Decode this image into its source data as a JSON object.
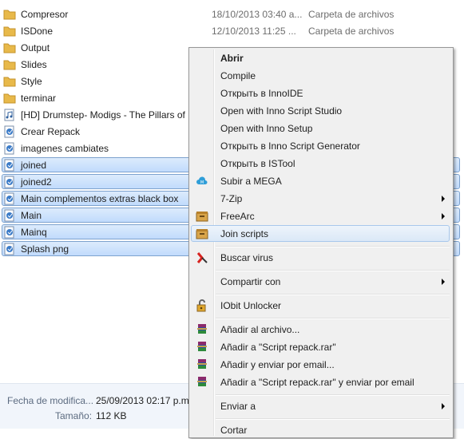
{
  "files": [
    {
      "name": "Compresor",
      "date": "18/10/2013 03:40 a...",
      "type": "Carpeta de archivos",
      "icon": "folder-icon",
      "selected": false
    },
    {
      "name": "ISDone",
      "date": "12/10/2013 11:25 ...",
      "type": "Carpeta de archivos",
      "icon": "folder-icon",
      "selected": false
    },
    {
      "name": "Output",
      "date": "",
      "type": "",
      "icon": "folder-icon",
      "selected": false
    },
    {
      "name": "Slides",
      "date": "",
      "type": "",
      "icon": "folder-icon",
      "selected": false
    },
    {
      "name": "Style",
      "date": "",
      "type": "",
      "icon": "folder-icon",
      "selected": false
    },
    {
      "name": "terminar",
      "date": "",
      "type": "",
      "icon": "folder-icon",
      "selected": false
    },
    {
      "name": "[HD] Drumstep- Modigs - The Pillars of",
      "date": "",
      "type": "",
      "icon": "audio-file-icon",
      "selected": false
    },
    {
      "name": "Crear Repack",
      "date": "",
      "type": "",
      "icon": "script-file-icon",
      "selected": false
    },
    {
      "name": "imagenes cambiates",
      "date": "",
      "type": "",
      "icon": "script-file-icon",
      "selected": false
    },
    {
      "name": "joined",
      "date": "",
      "type": "",
      "icon": "script-file-icon",
      "selected": true
    },
    {
      "name": "joined2",
      "date": "",
      "type": "",
      "icon": "script-file-icon",
      "selected": true
    },
    {
      "name": "Main complementos extras black box",
      "date": "",
      "type": "",
      "icon": "script-file-icon",
      "selected": true
    },
    {
      "name": "Main",
      "date": "",
      "type": "",
      "icon": "script-file-icon",
      "selected": true
    },
    {
      "name": "Mainq",
      "date": "",
      "type": "",
      "icon": "script-file-icon",
      "selected": true
    },
    {
      "name": "Splash png",
      "date": "",
      "type": "",
      "icon": "script-file-icon",
      "selected": true
    }
  ],
  "details": {
    "modified_label": "Fecha de modifica...",
    "modified_value": "25/09/2013 02:17 p.m.",
    "size_label": "Tamaño:",
    "size_value": "112 KB"
  },
  "menu": {
    "items": [
      {
        "label": "Abrir",
        "bold": true
      },
      {
        "label": "Compile"
      },
      {
        "label": "Открыть в InnoIDE"
      },
      {
        "label": "Open with Inno Script Studio"
      },
      {
        "label": "Open with Inno Setup"
      },
      {
        "label": "Открыть в Inno Script Generator"
      },
      {
        "label": "Открыть в ISTool"
      },
      {
        "label": "Subir a MEGA",
        "icon": "mega-cloud-icon"
      },
      {
        "label": "7-Zip",
        "submenu": true
      },
      {
        "label": "FreeArc",
        "icon": "freearc-icon",
        "submenu": true
      },
      {
        "label": "Join scripts",
        "icon": "join-scripts-icon",
        "highlighted": true
      },
      {
        "label": "Buscar virus",
        "icon": "antivirus-icon"
      },
      {
        "label": "Compartir con",
        "submenu": true
      },
      {
        "label": "IObit Unlocker",
        "icon": "unlocker-icon"
      },
      {
        "label": "Añadir al archivo...",
        "icon": "winrar-icon"
      },
      {
        "label": "Añadir a \"Script repack.rar\"",
        "icon": "winrar-icon"
      },
      {
        "label": "Añadir y enviar por email...",
        "icon": "winrar-icon"
      },
      {
        "label": "Añadir a \"Script repack.rar\" y enviar por email",
        "icon": "winrar-icon"
      },
      {
        "label": "Enviar a",
        "submenu": true
      },
      {
        "label": "Cortar"
      }
    ]
  },
  "colors": {
    "selection": "#cce1fb",
    "menu_bg": "#f0f0f0",
    "folder": "#e8b94a"
  }
}
